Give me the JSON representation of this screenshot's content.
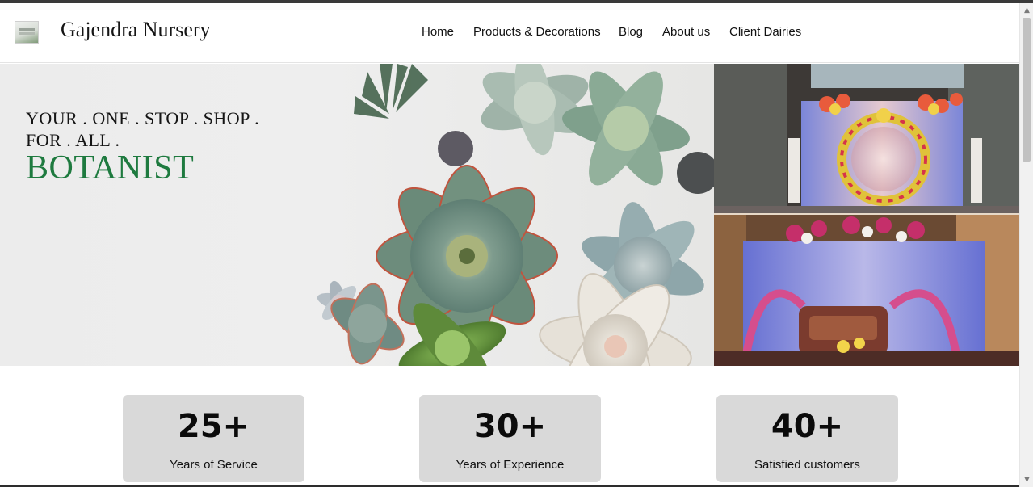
{
  "brand": {
    "name": "Gajendra Nursery",
    "logo_icon": "nursery-logo-icon"
  },
  "nav": {
    "items": [
      {
        "label": "Home"
      },
      {
        "label": "Products & Decorations"
      },
      {
        "label": "Blog"
      },
      {
        "label": "About us"
      },
      {
        "label": "Client Dairies"
      }
    ]
  },
  "hero": {
    "line1": "YOUR . ONE . STOP . SHOP .",
    "line2": "FOR . ALL .",
    "line3": "BOTANIST",
    "accent_color": "#1e7a3f",
    "left_image": "succulents-photo",
    "right_image": "wedding-stage-decoration-photo"
  },
  "stats": [
    {
      "number": "25+",
      "label": "Years of Service"
    },
    {
      "number": "30+",
      "label": "Years of Experience"
    },
    {
      "number": "40+",
      "label": "Satisfied customers"
    }
  ]
}
